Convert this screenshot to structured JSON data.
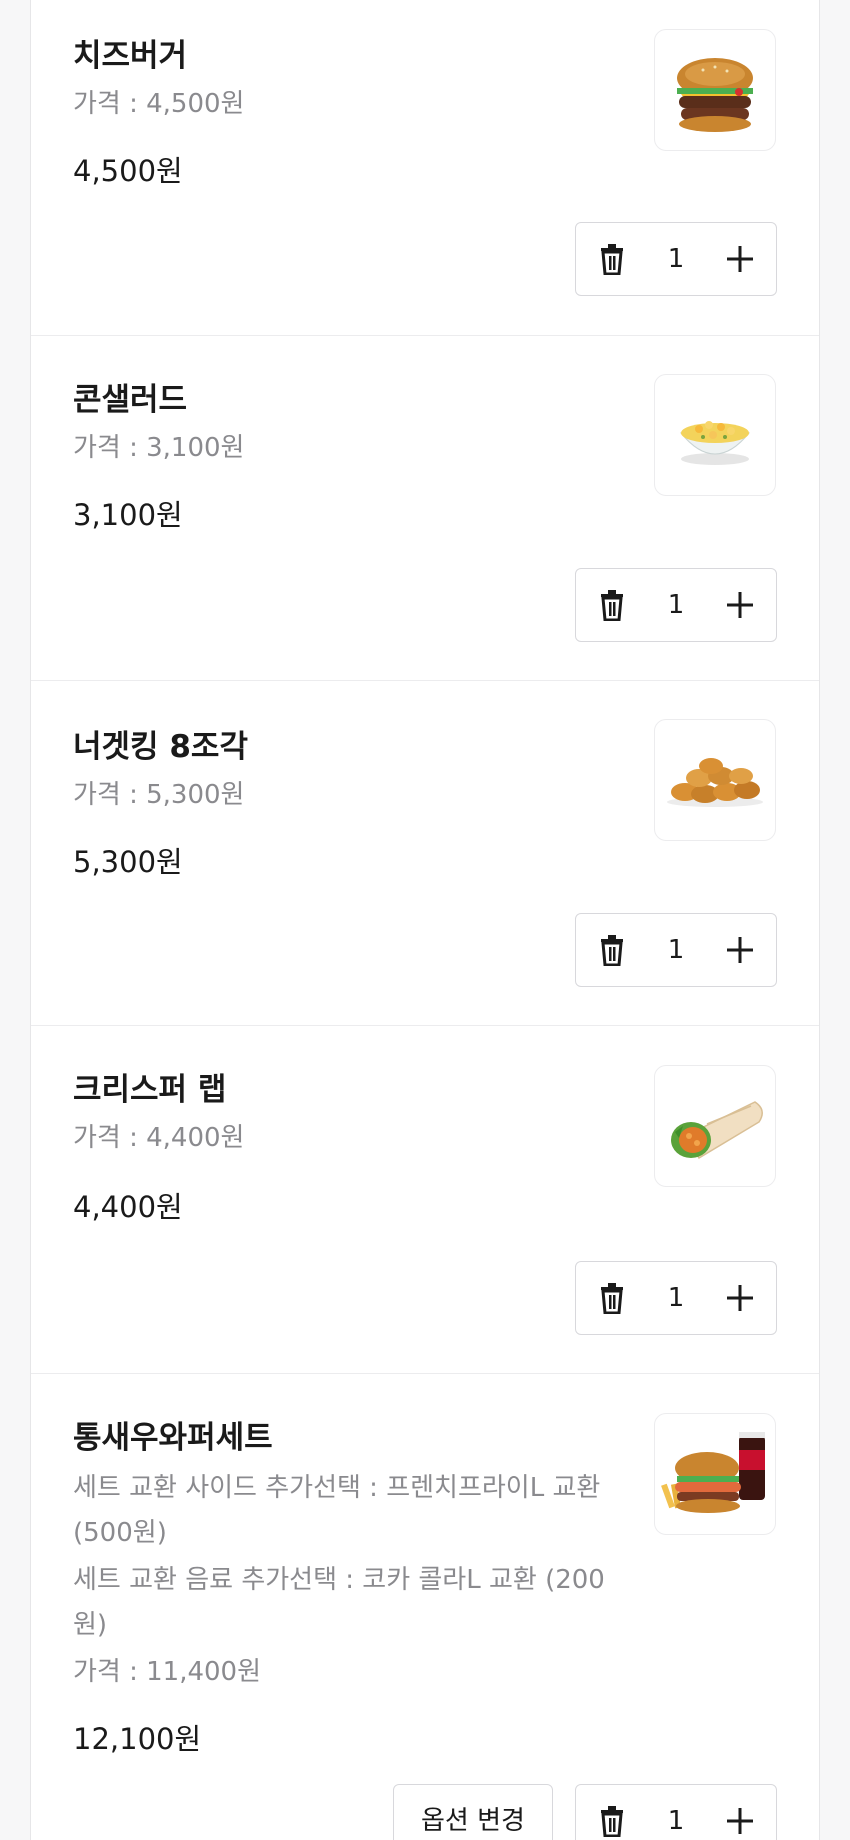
{
  "colors": {
    "text_primary": "#1a1a1a",
    "text_secondary": "#8a8a8e",
    "border": "#d8d8dc"
  },
  "cart": {
    "items": [
      {
        "name": "치즈버거",
        "options": [],
        "price": "가격 : 4,500원",
        "total": "4,500원",
        "quantity": "1",
        "image": "cheeseburger-image"
      },
      {
        "name": "콘샐러드",
        "options": [],
        "price": "가격 : 3,100원",
        "total": "3,100원",
        "quantity": "1",
        "image": "corn-salad-image"
      },
      {
        "name": "너겟킹 8조각",
        "options": [],
        "price": "가격 : 5,300원",
        "total": "5,300원",
        "quantity": "1",
        "image": "nuggets-image"
      },
      {
        "name": "크리스퍼 랩",
        "options": [],
        "price": "가격 : 4,400원",
        "total": "4,400원",
        "quantity": "1",
        "image": "wrap-image"
      },
      {
        "name": "통새우와퍼세트",
        "options": [
          "세트 교환 사이드 추가선택 : 프렌치프라이L 교환 (500원)",
          "세트 교환 음료 추가선택 : 코카 콜라L 교환 (200원)"
        ],
        "price": "가격 : 11,400원",
        "total": "12,100원",
        "quantity": "1",
        "option_change_label": "옵션 변경",
        "image": "shrimp-whopper-set-image"
      }
    ]
  }
}
